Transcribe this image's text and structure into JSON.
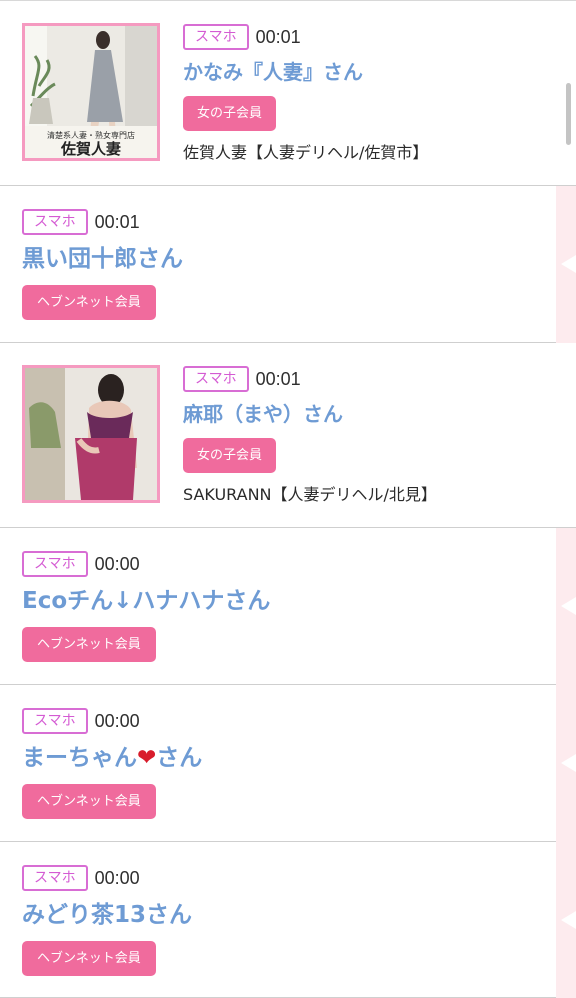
{
  "colors": {
    "badge_border": "#d86dd4",
    "badge_text": "#d45bd3",
    "name_text": "#6e9bd4",
    "button_bg": "#f06b9d",
    "thumb_border": "#f59ac0",
    "side_panel": "#fdebee"
  },
  "items": [
    {
      "device_badge": "スマホ",
      "time": "00:01",
      "name": "かなみ『人妻』さん",
      "member_label": "女の子会員",
      "shop": "佐賀人妻【人妻デリヘル/佐賀市】",
      "thumb_caption": "清楚系人妻・熟女専門店"
    },
    {
      "device_badge": "スマホ",
      "time": "00:01",
      "name": "黒い団十郎さん",
      "member_label": "ヘブンネット会員"
    },
    {
      "device_badge": "スマホ",
      "time": "00:01",
      "name": "麻耶（まや）さん",
      "member_label": "女の子会員",
      "shop": "SAKURANN【人妻デリヘル/北見】"
    },
    {
      "device_badge": "スマホ",
      "time": "00:00",
      "name": "Ecoチん↓ハナハナさん",
      "member_label": "ヘブンネット会員"
    },
    {
      "device_badge": "スマホ",
      "time": "00:00",
      "name_prefix": "まーちゃん",
      "name_heart": "❤",
      "name_suffix": "さん",
      "member_label": "ヘブンネット会員"
    },
    {
      "device_badge": "スマホ",
      "time": "00:00",
      "name": "みどり茶13さん",
      "member_label": "ヘブンネット会員"
    }
  ]
}
